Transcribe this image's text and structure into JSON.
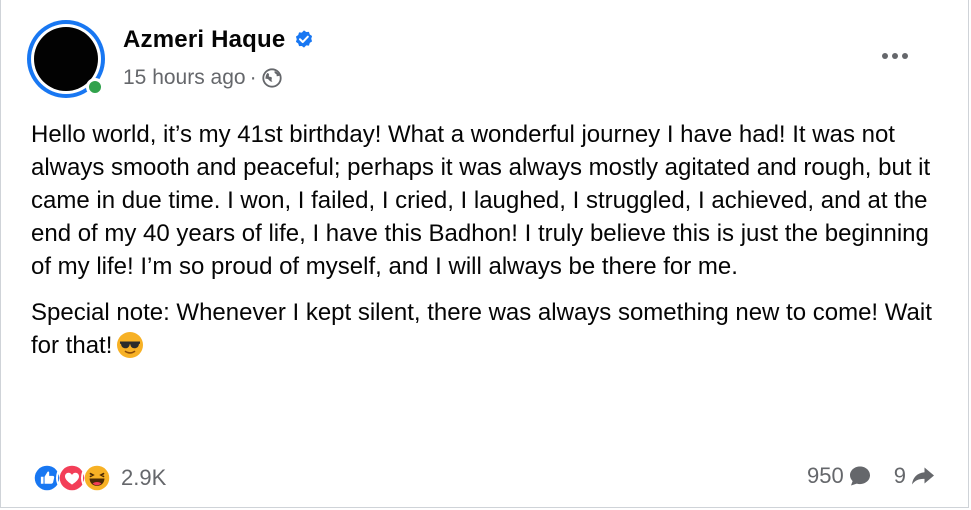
{
  "post": {
    "author": {
      "name": "Azmeri Haque",
      "verified": true,
      "online": true
    },
    "timestamp": "15 hours ago",
    "separator": "·",
    "audience_icon": "globe-icon",
    "more_icon": "more-options-icon",
    "paragraphs": [
      "Hello world, it’s my 41st birthday! What a wonderful journey I have had! It was not always smooth and peaceful; perhaps it was always mostly agitated and rough, but it came in due time. I won, I failed, I cried, I laughed, I struggled, I achieved, and at the end of my 40 years of life, I have this Badhon! I truly believe this is just the beginning of my life! I’m so proud of myself, and I will always be there for me.",
      "Special note: Whenever I kept silent, there was always something new to come! Wait for that!"
    ],
    "trailing_emoji": "sunglasses-emoji",
    "reactions": {
      "types": [
        "like",
        "love",
        "haha"
      ],
      "count": "2.9K"
    },
    "comments": {
      "count": "950",
      "icon": "comment-icon"
    },
    "shares": {
      "count": "9",
      "icon": "share-icon"
    }
  },
  "colors": {
    "accent_blue": "#1877f2",
    "online_green": "#31a24c",
    "secondary_text": "#65676b",
    "love_red": "#f33e58",
    "haha_yellow": "#f7b125"
  }
}
